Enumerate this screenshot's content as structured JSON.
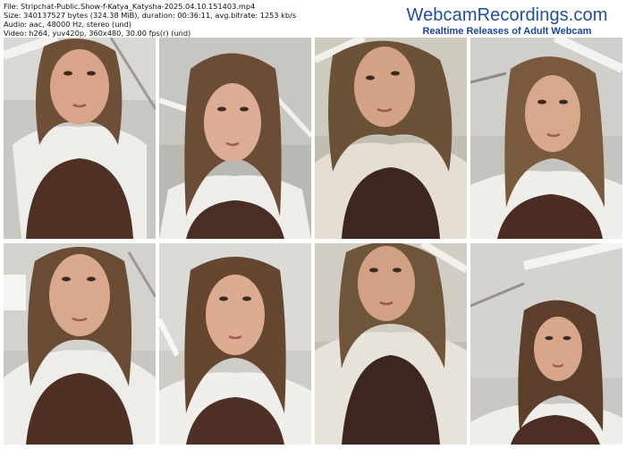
{
  "meta": {
    "file": "File: Stripchat-Public.Show-f-Katya_Katysha-2025.04.10.151403.mp4",
    "size": "Size: 340137527 bytes (324.38 MiB), duration: 00:36:11, avg.bitrate: 1253 kb/s",
    "audio": "Audio: aac, 48000 Hz, stereo (und)",
    "video": "Video: h264, yuv420p, 360x480, 30.00 fps(r) (und)"
  },
  "brand": {
    "name": "WebcamRecordings.com",
    "tagline": "Realtime Releases of Adult Webcam Recordings",
    "color_name": "#1f4fa0",
    "color_tagline": "#1d4597"
  },
  "frames": [
    {
      "id": "1"
    },
    {
      "id": "2"
    },
    {
      "id": "3"
    },
    {
      "id": "4"
    },
    {
      "id": "5"
    },
    {
      "id": "6"
    },
    {
      "id": "7"
    },
    {
      "id": "8"
    }
  ]
}
